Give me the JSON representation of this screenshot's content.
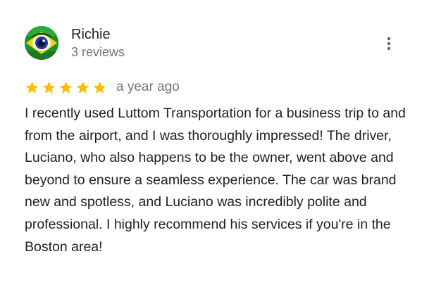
{
  "review": {
    "author": {
      "name": "Richie",
      "meta": "3 reviews",
      "avatar_icon": "avatar-eye-flag-image"
    },
    "more_icon": "more-vert-icon",
    "rating": {
      "stars": 5,
      "max_stars": 5,
      "star_icon": "star-icon",
      "color": "#fbbc04"
    },
    "date": "a year ago",
    "text": "I recently used Luttom Transportation for a business trip to and from the airport, and I was thoroughly impressed! The driver, Luciano, who also happens to be the owner, went above and beyond to ensure a seamless experience. The car was brand new and spotless, and Luciano was incredibly polite and professional. I highly recommend his services if you're in the Boston area!"
  },
  "colors": {
    "name": "#202124",
    "secondary": "#70757a",
    "star": "#fbbc04"
  }
}
